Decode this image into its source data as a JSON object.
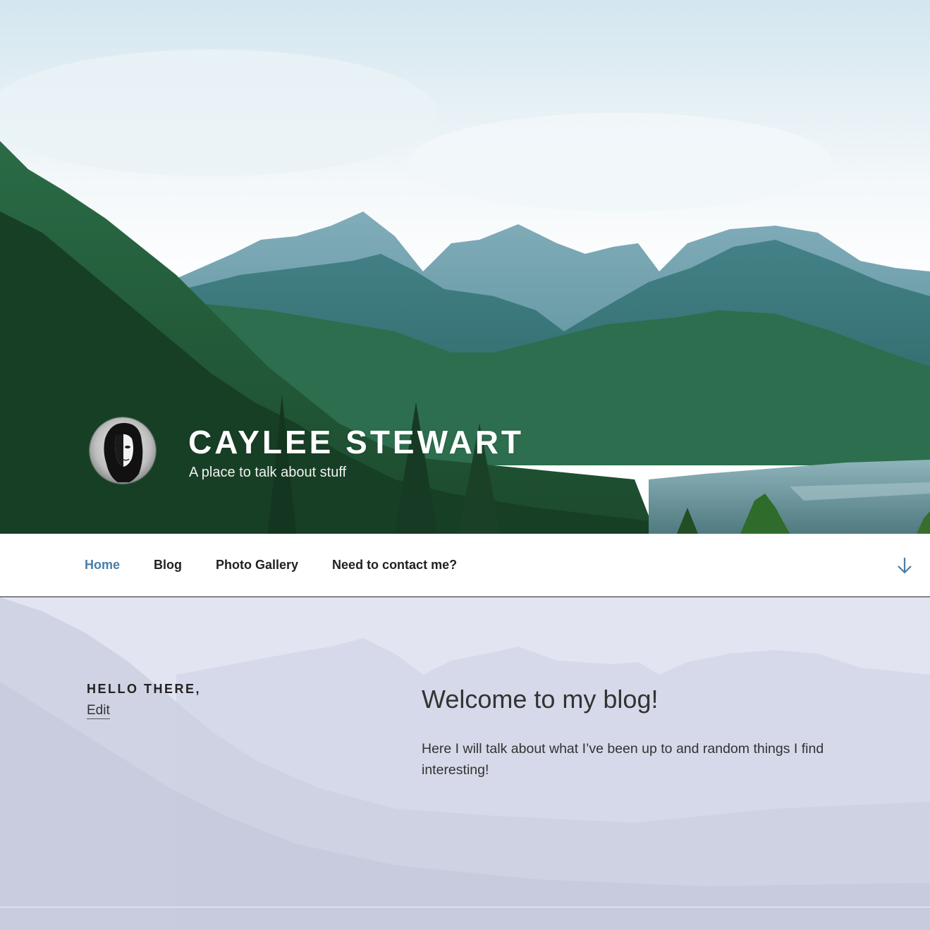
{
  "site": {
    "title": "CAYLEE STEWART",
    "description": "A place to talk about stuff"
  },
  "nav": {
    "items": [
      {
        "label": "Home",
        "current": true
      },
      {
        "label": "Blog",
        "current": false
      },
      {
        "label": "Photo Gallery",
        "current": false
      },
      {
        "label": "Need to contact me?",
        "current": false
      }
    ],
    "scroll_icon": "arrow-down-icon"
  },
  "panel": {
    "title": "HELLO THERE,",
    "edit_label": "Edit"
  },
  "post": {
    "title": "Welcome to my blog!",
    "body": "Here I will talk about what I’ve been up to and random things I find interesting!"
  },
  "colors": {
    "accent": "#4a7ea8",
    "text": "#222222",
    "panel_bg": "#dfe1ef"
  }
}
